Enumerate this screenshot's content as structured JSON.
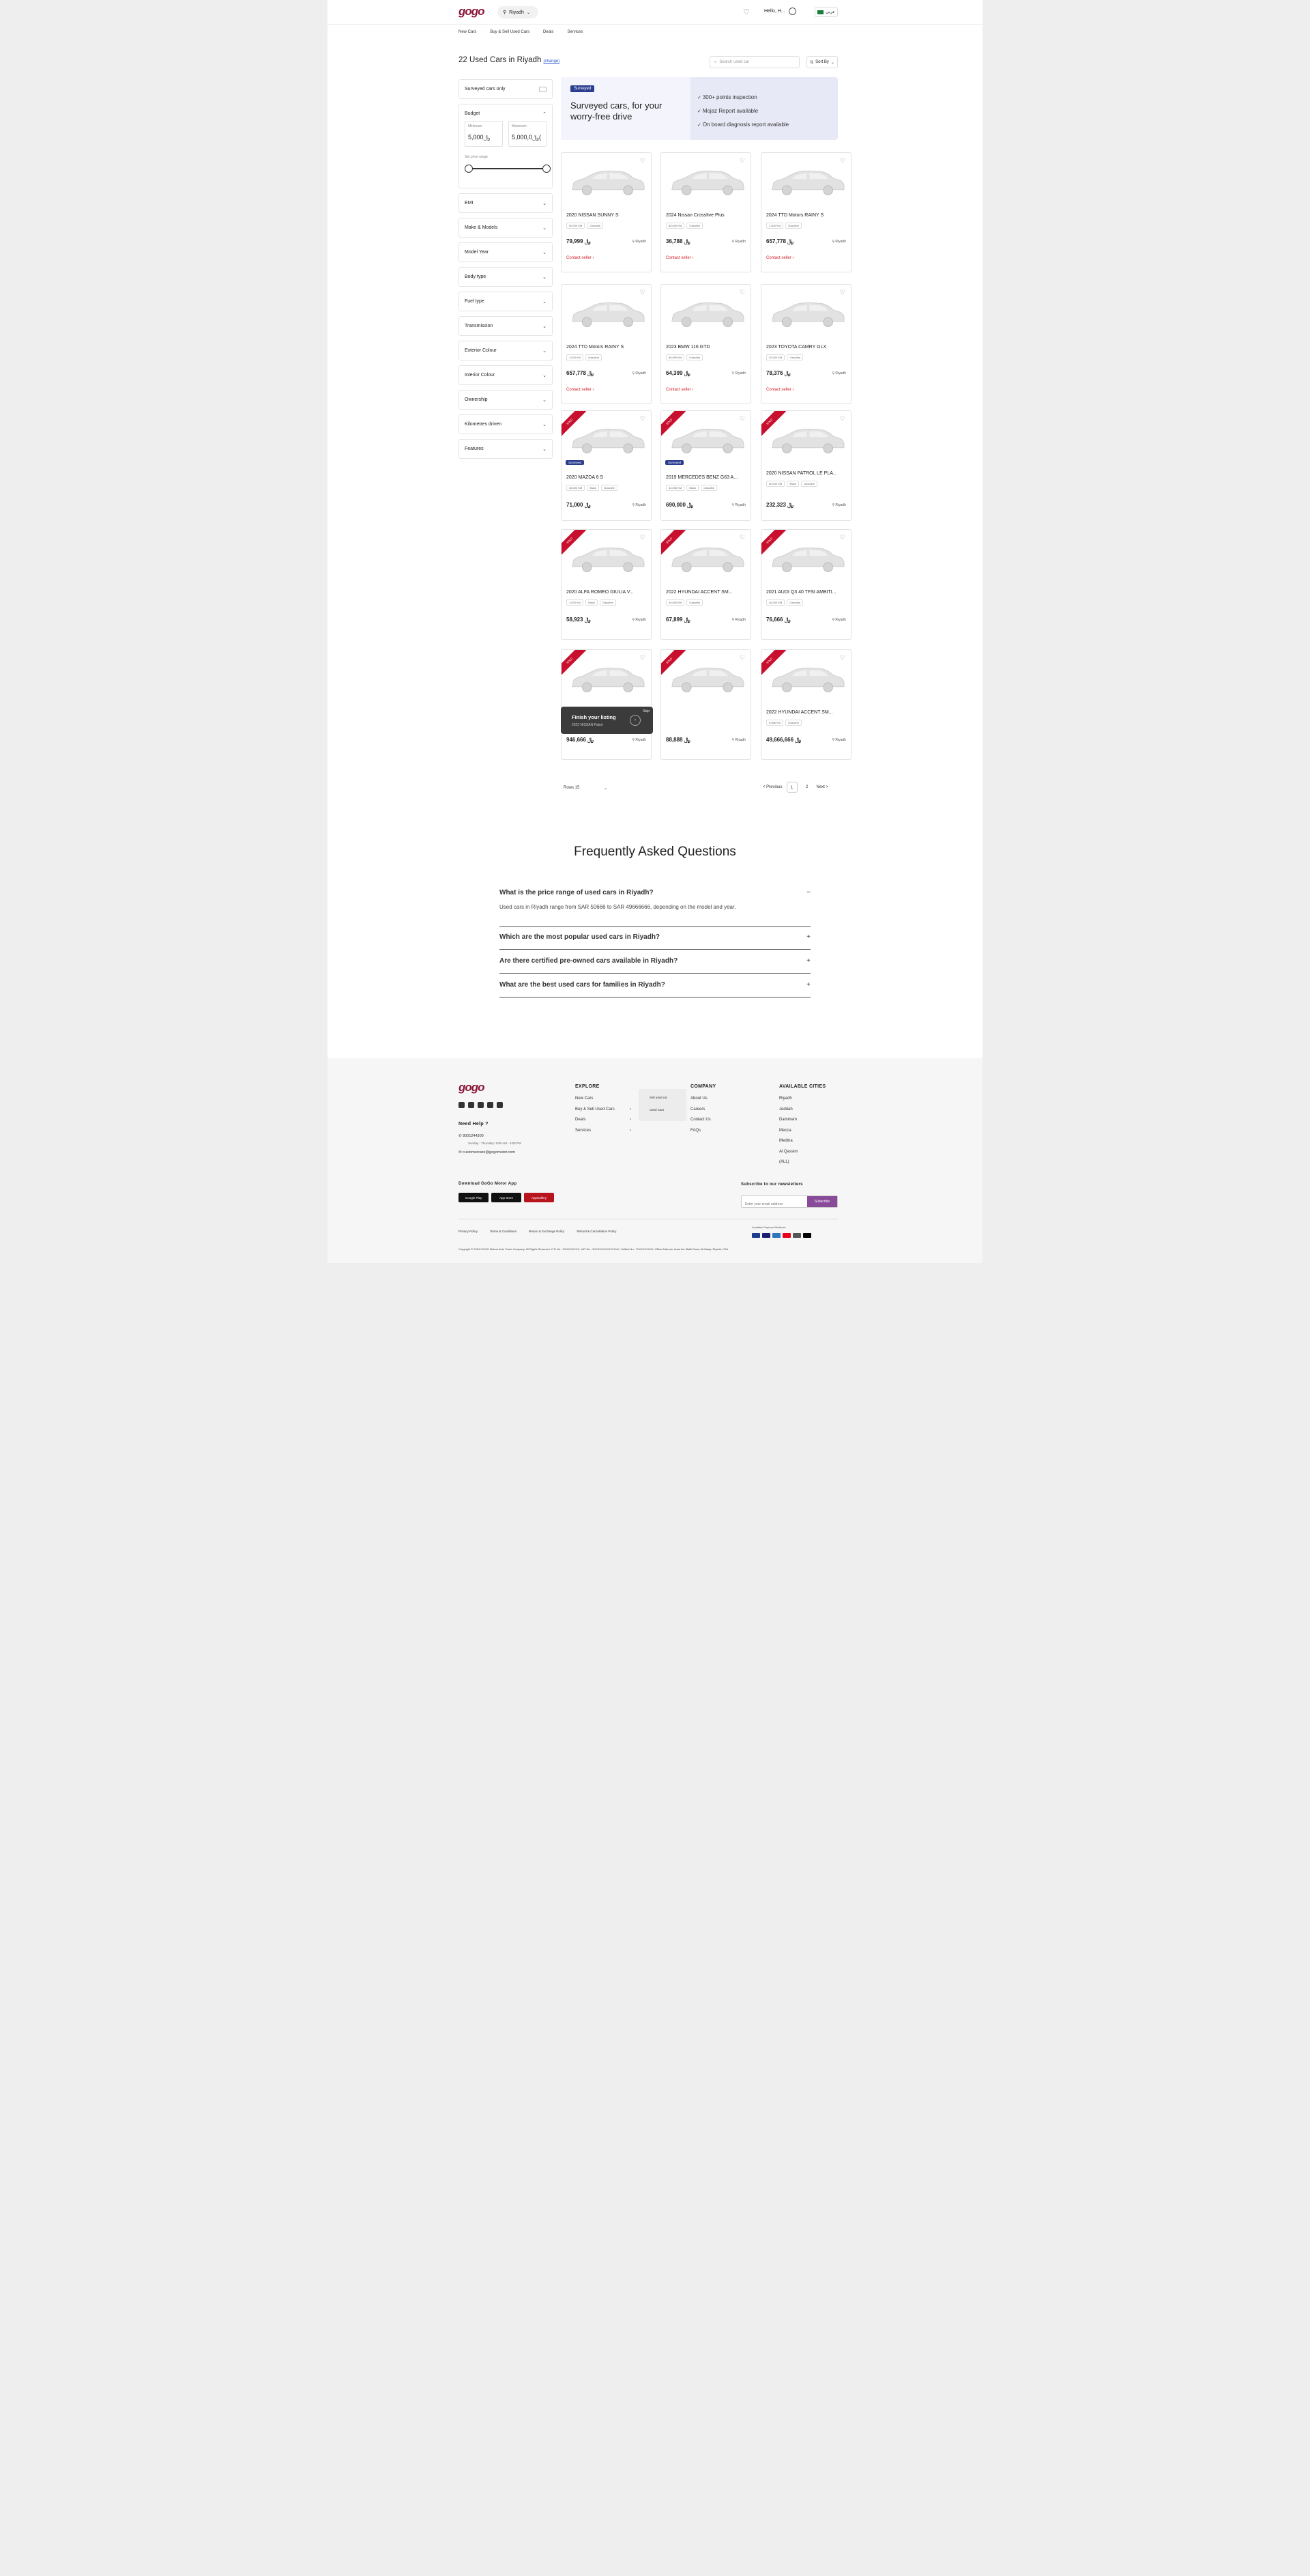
{
  "header": {
    "logo": "gogo",
    "city": "Riyadh",
    "greeting": "Hello, H...",
    "language": "عربي",
    "nav": [
      "New Cars",
      "Buy & Sell Used Cars",
      "Deals",
      "Services"
    ]
  },
  "listing": {
    "title": "22 Used Cars in Riyadh",
    "change_link": "(change)",
    "search_placeholder": "Search used car",
    "sort_label": "Sort By"
  },
  "filters": {
    "surveyed_only": "Surveyed cars only",
    "budget": {
      "label": "Budget",
      "min_label": "Minimum",
      "min_value": "5,000",
      "max_label": "Maximum",
      "max_value": "5,000,0(",
      "slider_label": "Set price range"
    },
    "sections": [
      "EMI",
      "Make & Models",
      "Model Year",
      "Body type",
      "Fuel type",
      "Transmission",
      "Exterior Colour",
      "Interior Colour",
      "Ownership",
      "Kilometres driven",
      "Features"
    ]
  },
  "banner": {
    "badge": "Surveyed",
    "headline": "Surveyed cars, for your worry-free drive",
    "points": [
      "300+ points inspection",
      "Mojaz Report available",
      "On board diagnosis report available"
    ]
  },
  "cars": [
    {
      "name": "2020 NISSAN SUNNY S",
      "tags": [
        "50,000 KM",
        "Gasoline"
      ],
      "price": "79,999",
      "city": "Riyadh",
      "contact": "Contact seller"
    },
    {
      "name": "2024 Nissan Crossfive Plus",
      "tags": [
        "80,000 KM",
        "Gasoline"
      ],
      "price": "36,788",
      "city": "Riyadh",
      "contact": "Contact seller"
    },
    {
      "name": "2024 TTD Motors RAINY S",
      "tags": [
        "1,000 KM",
        "Gasoline"
      ],
      "price": "657,778",
      "city": "Riyadh",
      "contact": "Contact seller"
    },
    {
      "name": "2024 TTD Motors RAINY S",
      "tags": [
        "1,000 KM",
        "Gasoline"
      ],
      "price": "657,778",
      "city": "Riyadh",
      "contact": "Contact seller"
    },
    {
      "name": "2023 BMW 116 GTD",
      "tags": [
        "80,000 KM",
        "Gasoline"
      ],
      "price": "64,399",
      "city": "Riyadh",
      "contact": "Contact seller"
    },
    {
      "name": "2023 TOYOTA CAMRY GLX",
      "tags": [
        "20,000 KM",
        "Gasoline"
      ],
      "price": "78,376",
      "city": "Riyadh",
      "contact": "Contact seller"
    },
    {
      "name": "2020 MAZDA 6 S",
      "tags": [
        "46,000 KM",
        "Black",
        "Gasoline"
      ],
      "price": "71,000",
      "city": "Riyadh",
      "surveyed": "Surveyed",
      "ribbon": "SOLD"
    },
    {
      "name": "2019 MERCEDES BENZ G63 A...",
      "tags": [
        "42,000 KM",
        "Black",
        "Gasoline"
      ],
      "price": "690,000",
      "city": "Riyadh",
      "surveyed": "Surveyed",
      "ribbon": "SOLD"
    },
    {
      "name": "2020 NISSAN PATROL LE PLA...",
      "tags": [
        "80,000 KM",
        "Black",
        "Gasoline"
      ],
      "price": "232,323",
      "city": "Riyadh",
      "ribbon": "SOLD"
    },
    {
      "name": "2020 ALFA ROMEO GIULIA V...",
      "tags": [
        "1,000 KM",
        "Black",
        "Gasoline"
      ],
      "price": "58,923",
      "city": "Riyadh",
      "ribbon": "SOLD"
    },
    {
      "name": "2022 HYUNDAI ACCENT SM...",
      "tags": [
        "40,000 KM",
        "Gasoline"
      ],
      "price": "67,899",
      "city": "Riyadh",
      "ribbon": "SOLD"
    },
    {
      "name": "2021 AUDI Q3 40 TFSI AMBITI...",
      "tags": [
        "40,000 KM",
        "Gasoline"
      ],
      "price": "76,666",
      "city": "Riyadh",
      "ribbon": "SOLD"
    },
    {
      "name": "",
      "tags": [],
      "price": "946,666",
      "city": "Riyadh",
      "ribbon": "SOLD"
    },
    {
      "name": "",
      "tags": [],
      "price": "88,888",
      "city": "Riyadh",
      "ribbon": "SOLD"
    },
    {
      "name": "2022 HYUNDAI ACCENT SM...",
      "tags": [
        "6,666 KM",
        "Gasoline"
      ],
      "price": "49,666,666",
      "city": "Riyadh",
      "ribbon": "SOLD"
    }
  ],
  "toast": {
    "title": "Finish your listing",
    "subtitle": "2022 NISSAN Patrol",
    "close": "Skip"
  },
  "pagination": {
    "rows": "Rows 15",
    "previous": "< Previous",
    "pages": [
      "1",
      "2"
    ],
    "next": "Next >"
  },
  "faq": {
    "title": "Frequently Asked Questions",
    "items": [
      {
        "q": "What is the price range of used cars in Riyadh?",
        "sign": "−",
        "a": "Used cars in Riyadh range from SAR 50666 to SAR 49666666, depending on the model and year."
      },
      {
        "q": "Which are the most popular used cars in Riyadh?",
        "sign": "+"
      },
      {
        "q": "Are there certified pre-owned cars available in Riyadh?",
        "sign": "+"
      },
      {
        "q": "What are the best used cars for families in Riyadh?",
        "sign": "+"
      }
    ]
  },
  "footer": {
    "need_help": "Need Help ?",
    "phone": "8001244300",
    "hours": "Sunday - Thursday: 9:00 AM - 6:00 PM",
    "email": "customercare@gogomotor.com",
    "download_title": "Download GoGo Motor App",
    "stores": [
      "Google Play",
      "App Store",
      "AppGallery"
    ],
    "explore_title": "EXPLORE",
    "explore": [
      "New Cars",
      "Buy & Sell Used Cars",
      "Deals",
      "Services"
    ],
    "explore_sub": [
      "Sell used car",
      "Used Cars"
    ],
    "company_title": "COMPANY",
    "company": [
      "About Us",
      "Careers",
      "Contact Us",
      "FAQs"
    ],
    "cities_title": "AVAILABLE CITIES",
    "cities": [
      "Riyadh",
      "Jeddah",
      "Dammam",
      "Mecca",
      "Medina",
      "Al Qassim",
      "(ALL)"
    ],
    "newsletter_title": "Subscribe to our newsletters",
    "newsletter_placeholder": "Enter your email address",
    "subscribe": "Subscribe",
    "legal": [
      "Privacy Policy",
      "Terms & Conditions",
      "Return & Exchange Policy",
      "Refund & Cancellation Policy"
    ],
    "payment_title": "Available Payment Methods",
    "copyright": "Copyright © 2024 GOGO Motors Auto Trade Company. All Rights Reserved. C.R No.: 1010XXXXXX, VAT No.: 3XXXXXXXXXXXXXX, Unified No.: 70XXXXXXXX, Office Address: Anas Ibn Malik Road, Al Malqa, Riyadh, KSA"
  }
}
